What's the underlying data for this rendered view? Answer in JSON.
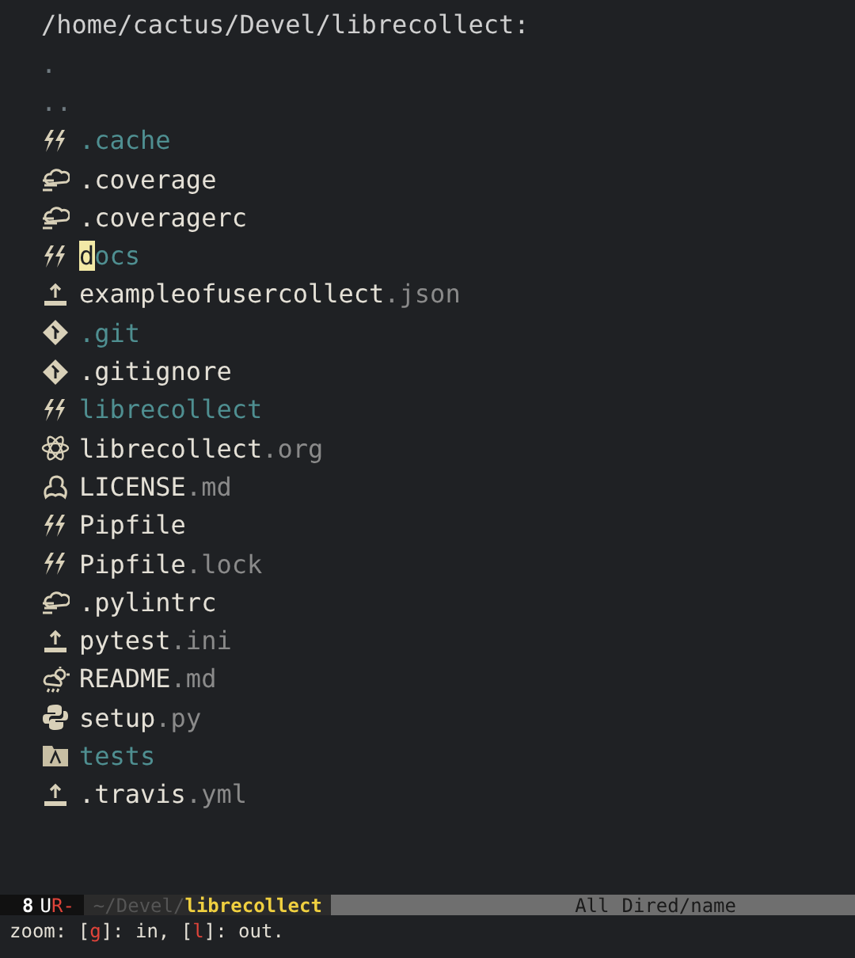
{
  "header": {
    "path": "/home/cactus/Devel/librecollect:"
  },
  "entries": [
    {
      "kind": "dot",
      "name": "."
    },
    {
      "kind": "dot",
      "name": ".."
    },
    {
      "kind": "dir",
      "name": ".cache"
    },
    {
      "kind": "file",
      "name": ".coverage"
    },
    {
      "kind": "file",
      "name": ".coveragerc"
    },
    {
      "kind": "dir",
      "name": "docs",
      "cursor": true
    },
    {
      "kind": "file",
      "name": "exampleofusercollect",
      "ext": ".json"
    },
    {
      "kind": "dir",
      "name": ".git"
    },
    {
      "kind": "file",
      "name": ".gitignore"
    },
    {
      "kind": "dir",
      "name": "librecollect"
    },
    {
      "kind": "file",
      "name": "librecollect",
      "ext": ".org"
    },
    {
      "kind": "file",
      "name": "LICENSE",
      "ext": ".md"
    },
    {
      "kind": "file",
      "name": "Pipfile"
    },
    {
      "kind": "file",
      "name": "Pipfile",
      "ext": ".lock"
    },
    {
      "kind": "file",
      "name": ".pylintrc"
    },
    {
      "kind": "file",
      "name": "pytest",
      "ext": ".ini"
    },
    {
      "kind": "file",
      "name": "README",
      "ext": ".md"
    },
    {
      "kind": "file",
      "name": "setup",
      "ext": ".py"
    },
    {
      "kind": "dir",
      "name": "tests"
    },
    {
      "kind": "file",
      "name": ".travis",
      "ext": ".yml"
    }
  ],
  "mode_line": {
    "window_number": "8",
    "encoding": "U",
    "flags": "R-",
    "directory": "~/Devel/",
    "buffer": "librecollect",
    "position": "All",
    "mode": "Dired/name"
  },
  "echo_area": [
    {
      "kind": "plain",
      "text": "zoom: ["
    },
    {
      "kind": "key",
      "text": "g"
    },
    {
      "kind": "plain",
      "text": "]: in, ["
    },
    {
      "kind": "key",
      "text": "l"
    },
    {
      "kind": "plain",
      "text": "]: out."
    }
  ]
}
